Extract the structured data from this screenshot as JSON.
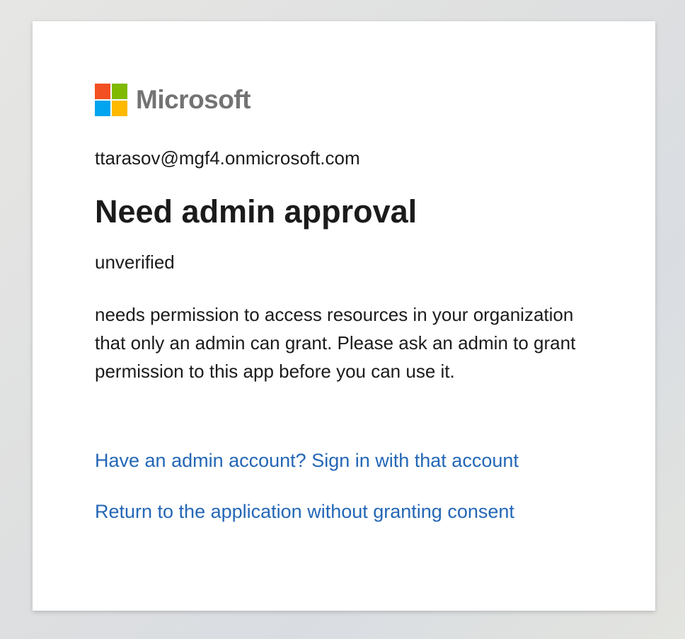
{
  "brand": {
    "name": "Microsoft",
    "logo_icon": "microsoft-four-squares-logo",
    "colors": {
      "red": "#f25022",
      "green": "#7fba00",
      "blue": "#00a4ef",
      "yellow": "#ffb900",
      "link": "#2467b6"
    }
  },
  "account": {
    "email": "ttarasov@mgf4.onmicrosoft.com"
  },
  "dialog": {
    "title": "Need admin approval",
    "app_status": "unverified",
    "description": "needs permission to access resources in your organization that only an admin can grant. Please ask an admin to grant permission to this app before you can use it."
  },
  "links": {
    "admin_signin": "Have an admin account? Sign in with that account",
    "return_without_consent": "Return to the application without granting consent"
  }
}
